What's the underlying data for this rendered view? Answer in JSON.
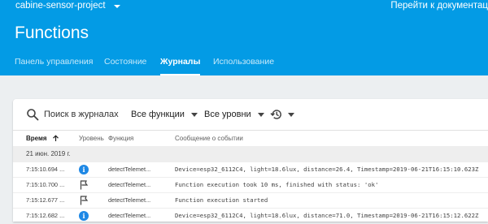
{
  "header": {
    "project_name": "cabine-sensor-project",
    "docs_link": "Перейти к документац",
    "title": "Functions",
    "tabs": [
      {
        "label": "Панель управления",
        "active": false
      },
      {
        "label": "Состояние",
        "active": false
      },
      {
        "label": "Журналы",
        "active": true
      },
      {
        "label": "Использование",
        "active": false
      }
    ]
  },
  "toolbar": {
    "search_placeholder": "Поиск в журналах",
    "functions_filter": "Все функции",
    "levels_filter": "Все уровни"
  },
  "table": {
    "columns": {
      "time": "Время",
      "level": "Уровень",
      "function": "Функция",
      "message": "Сообщение о событии"
    },
    "date_group": "21 июн. 2019 г.",
    "rows": [
      {
        "time": "7:15:10.694 ...",
        "level": "info",
        "function": "detectTelemet...",
        "message": "Device=esp32_6112C4, light=18.6lux, distance=26.4, Timestamp=2019-06-21T16:15:10.623Z"
      },
      {
        "time": "7:15:10.700 ...",
        "level": "debug",
        "function": "detectTelemet...",
        "message": "Function execution took 10 ms, finished with status: 'ok'"
      },
      {
        "time": "7:15:12.677 ...",
        "level": "debug",
        "function": "detectTelemet...",
        "message": "Function execution started"
      },
      {
        "time": "7:15:12.682 ...",
        "level": "info",
        "function": "detectTelemet...",
        "message": "Device=esp32_6112C4, light=18.6lux, distance=71.0, Timestamp=2019-06-21T16:15:12.622Z"
      }
    ]
  },
  "colors": {
    "header_bg": "#039be5",
    "info_icon": "#1e88e5"
  }
}
